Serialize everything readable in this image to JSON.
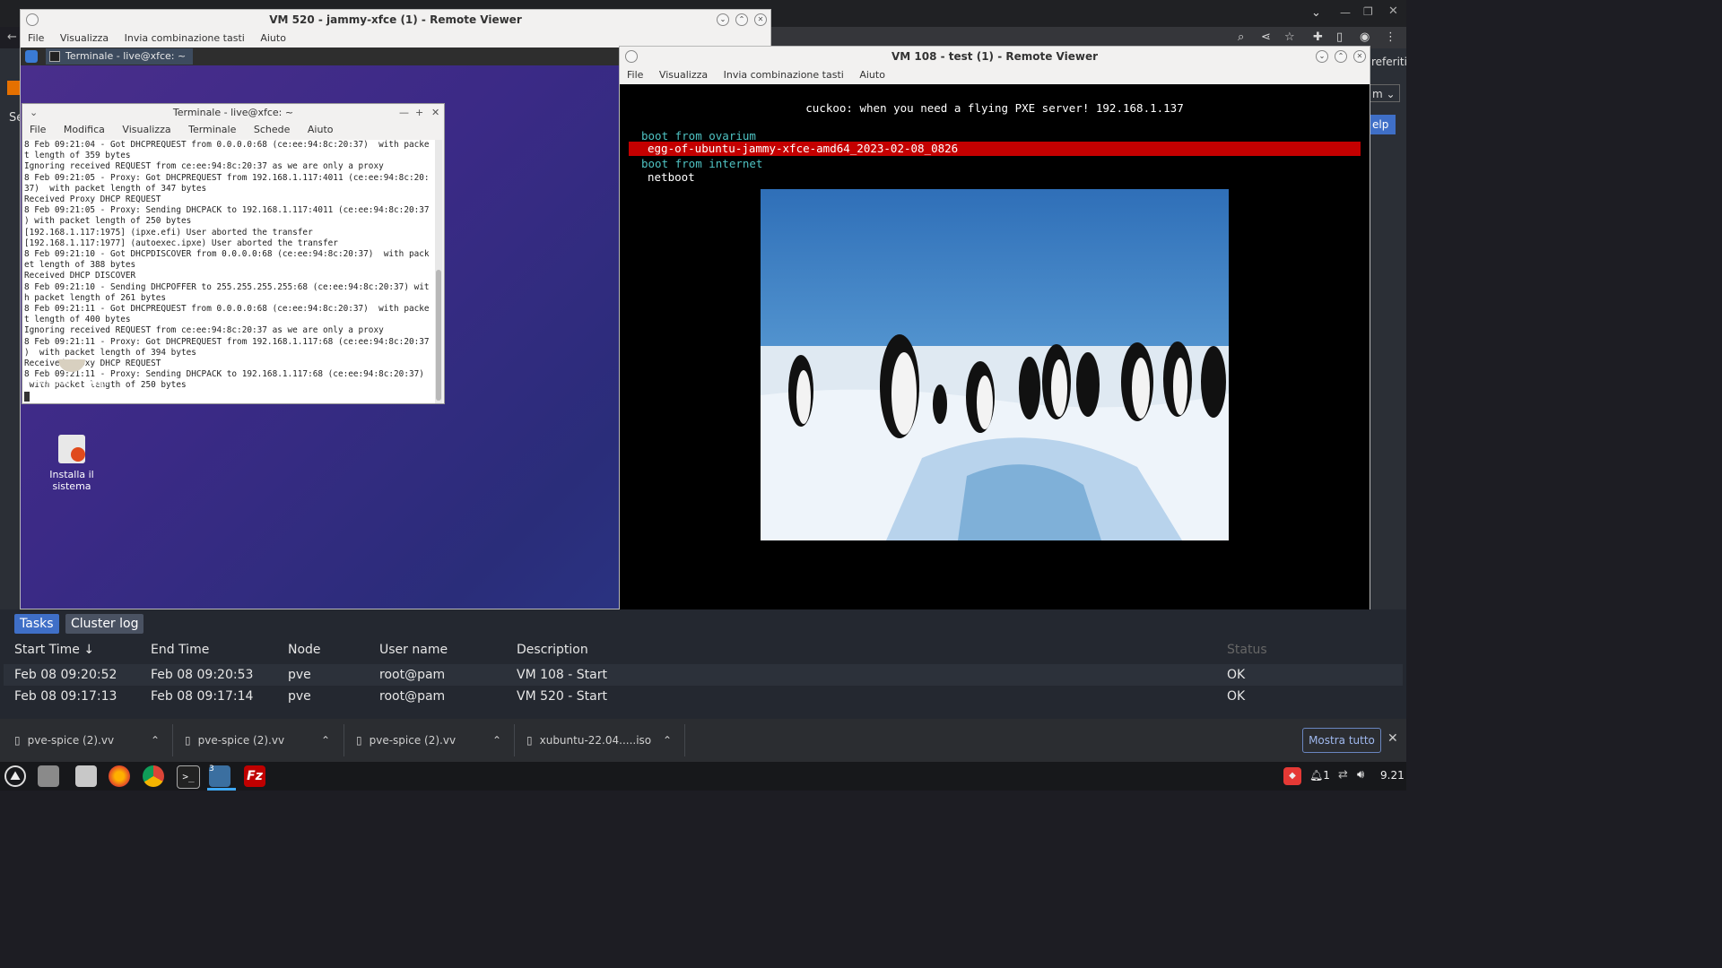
{
  "vm520": {
    "title": "VM 520 - jammy-xfce (1) - Remote Viewer",
    "menu": [
      "File",
      "Visualizza",
      "Invia combinazione tasti",
      "Aiuto"
    ],
    "panel_task": "Terminale - live@xfce: ~",
    "terminal": {
      "title": "Terminale - live@xfce: ~",
      "menu": [
        "File",
        "Modifica",
        "Visualizza",
        "Terminale",
        "Schede",
        "Aiuto"
      ],
      "lines": [
        "8 Feb 09:21:04 - Got DHCPREQUEST from 0.0.0.0:68 (ce:ee:94:8c:20:37)  with packe",
        "t length of 359 bytes",
        "Ignoring received REQUEST from ce:ee:94:8c:20:37 as we are only a proxy",
        "8 Feb 09:21:05 - Proxy: Got DHCPREQUEST from 192.168.1.117:4011 (ce:ee:94:8c:20:",
        "37)  with packet length of 347 bytes",
        "Received Proxy DHCP REQUEST",
        "8 Feb 09:21:05 - Proxy: Sending DHCPACK to 192.168.1.117:4011 (ce:ee:94:8c:20:37",
        ") with packet length of 250 bytes",
        "[192.168.1.117:1975] (ipxe.efi) User aborted the transfer",
        "[192.168.1.117:1977] (autoexec.ipxe) User aborted the transfer",
        "8 Feb 09:21:10 - Got DHCPDISCOVER from 0.0.0.0:68 (ce:ee:94:8c:20:37)  with pack",
        "et length of 388 bytes",
        "Received DHCP DISCOVER",
        "8 Feb 09:21:10 - Sending DHCPOFFER to 255.255.255.255:68 (ce:ee:94:8c:20:37) wit",
        "h packet length of 261 bytes",
        "8 Feb 09:21:11 - Got DHCPREQUEST from 0.0.0.0:68 (ce:ee:94:8c:20:37)  with packe",
        "t length of 400 bytes",
        "Ignoring received REQUEST from ce:ee:94:8c:20:37 as we are only a proxy",
        "8 Feb 09:21:11 - Proxy: Got DHCPREQUEST from 192.168.1.117:68 (ce:ee:94:8c:20:37",
        ")  with packet length of 394 bytes",
        "Received Proxy DHCP REQUEST",
        "8 Feb 09:21:11 - Proxy: Sending DHCPACK to 192.168.1.117:68 (ce:ee:94:8c:20:37)",
        " with packet length of 250 bytes"
      ]
    },
    "desktop_icons": [
      "Penguin's eggs",
      "Installa il\nsistema"
    ]
  },
  "vm108": {
    "title": "VM 108 - test (1) - Remote Viewer",
    "menu": [
      "File",
      "Visualizza",
      "Invia combinazione tasti",
      "Aiuto"
    ],
    "boot": {
      "header": "cuckoo: when you need a flying PXE server! 192.168.1.137",
      "items": [
        {
          "text": "boot from ovarium",
          "type": "section"
        },
        {
          "text": "egg-of-ubuntu-jammy-xfce-amd64_2023-02-08_0826",
          "type": "selected"
        },
        {
          "text": "boot from internet",
          "type": "section"
        },
        {
          "text": "netboot",
          "type": "entry"
        }
      ]
    }
  },
  "background_browser": {
    "right_labels": [
      "referiti",
      "m",
      "elp"
    ],
    "left_label": "Se"
  },
  "tasks": {
    "tabs": [
      "Tasks",
      "Cluster log"
    ],
    "columns": [
      "Start Time",
      "End Time",
      "Node",
      "User name",
      "Description",
      "Status"
    ],
    "rows": [
      {
        "start": "Feb 08 09:20:52",
        "end": "Feb 08 09:20:53",
        "node": "pve",
        "user": "root@pam",
        "desc": "VM 108 - Start",
        "status": "OK"
      },
      {
        "start": "Feb 08 09:17:13",
        "end": "Feb 08 09:17:14",
        "node": "pve",
        "user": "root@pam",
        "desc": "VM 520 - Start",
        "status": "OK"
      }
    ]
  },
  "downloads": {
    "items": [
      "pve-spice (2).vv",
      "pve-spice (2).vv",
      "pve-spice (2).vv",
      "xubuntu-22.04.....iso"
    ],
    "show_all": "Mostra tutto"
  },
  "taskbar": {
    "badge_count": "3",
    "tray_count": "1",
    "clock": "9.21"
  },
  "colors": {
    "boot_section": "#4fc3c3",
    "boot_selected_bg": "#c40000",
    "task_tab_active": "#3f6fc7"
  }
}
